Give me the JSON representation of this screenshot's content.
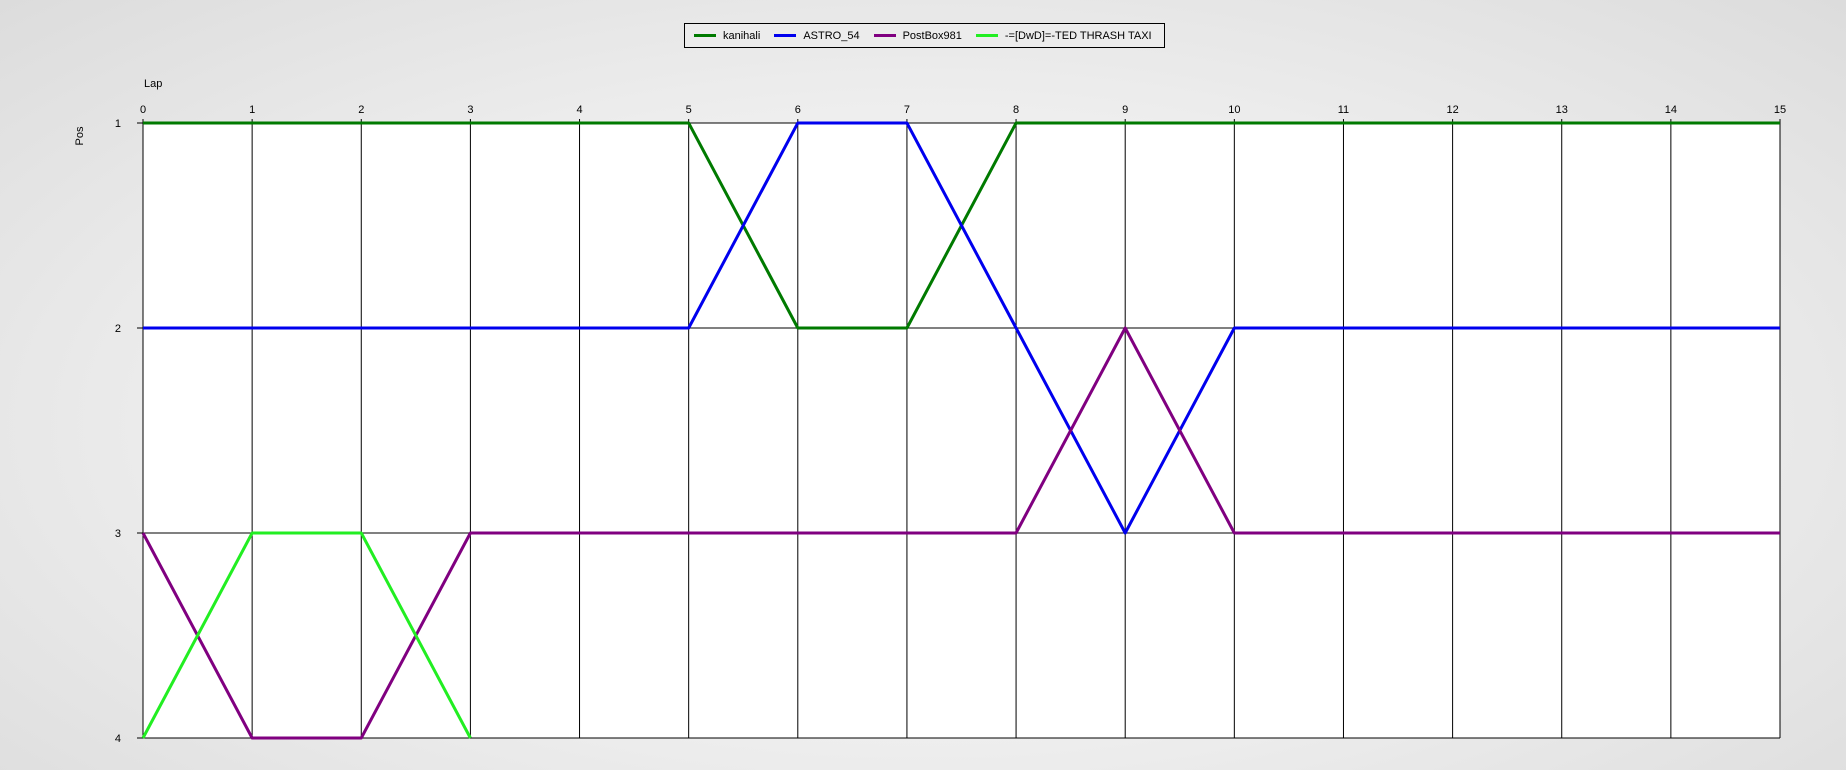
{
  "chart_data": {
    "type": "line",
    "title": "",
    "xlabel": "Lap",
    "ylabel": "Pos",
    "x": [
      0,
      1,
      2,
      3,
      4,
      5,
      6,
      7,
      8,
      9,
      10,
      11,
      12,
      13,
      14,
      15
    ],
    "xlim": [
      0,
      15
    ],
    "ylim": [
      1,
      4
    ],
    "y_inverted": true,
    "y_ticks": [
      1,
      2,
      3,
      4
    ],
    "grid": true,
    "legend_position": "top-center",
    "series": [
      {
        "name": "kanihali",
        "color": "#007a00",
        "values": [
          1,
          1,
          1,
          1,
          1,
          1,
          2,
          2,
          1,
          1,
          1,
          1,
          1,
          1,
          1,
          1
        ]
      },
      {
        "name": "ASTRO_54",
        "color": "#0000ee",
        "values": [
          2,
          2,
          2,
          2,
          2,
          2,
          1,
          1,
          2,
          3,
          2,
          2,
          2,
          2,
          2,
          2
        ]
      },
      {
        "name": "PostBox981",
        "color": "#800080",
        "values": [
          3,
          4,
          4,
          3,
          3,
          3,
          3,
          3,
          3,
          2,
          3,
          3,
          3,
          3,
          3,
          3
        ]
      },
      {
        "name": "-=[DwD]=-TED THRASH TAXI",
        "color": "#22ee22",
        "values": [
          4,
          3,
          3,
          4
        ]
      }
    ]
  }
}
